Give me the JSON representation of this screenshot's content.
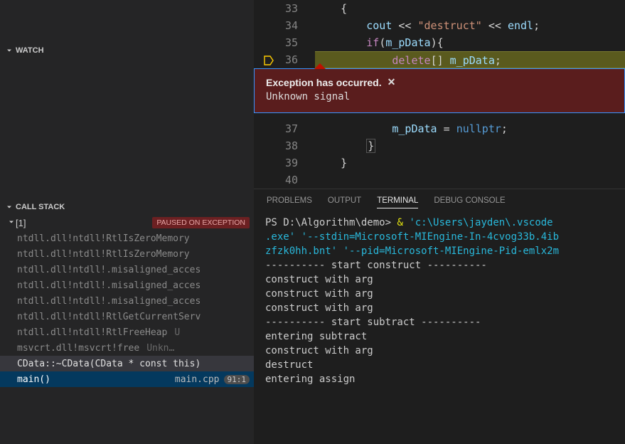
{
  "sidebar": {
    "watch": {
      "title": "WATCH"
    },
    "callstack": {
      "title": "CALL STACK",
      "thread": {
        "label": "[1]",
        "badge": "PAUSED ON EXCEPTION"
      },
      "frames": [
        {
          "label": "ntdll.dll!ntdll!RtlIsZeroMemory"
        },
        {
          "label": "ntdll.dll!ntdll!RtlIsZeroMemory"
        },
        {
          "label": "ntdll.dll!ntdll!.misaligned_acces"
        },
        {
          "label": "ntdll.dll!ntdll!.misaligned_acces"
        },
        {
          "label": "ntdll.dll!ntdll!.misaligned_acces"
        },
        {
          "label": "ntdll.dll!ntdll!RtlGetCurrentServ"
        },
        {
          "label": "ntdll.dll!ntdll!RtlFreeHeap",
          "extra": "U"
        },
        {
          "label": "msvcrt.dll!msvcrt!free",
          "extra": "Unkn…"
        }
      ],
      "active_frame": {
        "label": "CData::~CData(CData * const this)"
      },
      "selected_frame": {
        "label": "main()",
        "file": "main.cpp",
        "loc": "91:1"
      }
    }
  },
  "editor": {
    "lines": [
      {
        "num": "33"
      },
      {
        "num": "34"
      },
      {
        "num": "35"
      },
      {
        "num": "36"
      },
      {
        "num": "37"
      },
      {
        "num": "38"
      },
      {
        "num": "39"
      },
      {
        "num": "40"
      }
    ],
    "tokens": {
      "l33": "{",
      "l34_cout": "cout",
      "l34_op1": " << ",
      "l34_str": "\"destruct\"",
      "l34_op2": " << ",
      "l34_endl": "endl",
      "l34_semi": ";",
      "l35_if": "if",
      "l35_open": "(",
      "l35_var": "m_pData",
      "l35_close": "){",
      "l36_del": "delete",
      "l36_br": "[] ",
      "l36_var": "m_pData",
      "l36_semi": ";",
      "l37_var": "m_pData",
      "l37_eq": " = ",
      "l37_null": "nullptr",
      "l37_semi": ";",
      "l38": "}",
      "l39": "}"
    }
  },
  "exception": {
    "title": "Exception has occurred.",
    "message": "Unknown signal"
  },
  "panel": {
    "tabs": {
      "problems": "PROBLEMS",
      "output": "OUTPUT",
      "terminal": "TERMINAL",
      "debug": "DEBUG CONSOLE"
    }
  },
  "terminal": {
    "prompt_prefix": "PS ",
    "prompt_path": "D:\\Algorithm\\demo> ",
    "amp": "& ",
    "cmd1": "'c:\\Users\\jayden\\.vscode",
    "cmd2": ".exe' '--stdin=Microsoft-MIEngine-In-4cvog33b.4ib",
    "cmd3": "zfzk0hh.bnt' '--pid=Microsoft-MIEngine-Pid-emlx2m",
    "out": [
      "---------- start construct ----------",
      "construct with arg",
      "construct with arg",
      "construct with arg",
      "---------- start subtract ----------",
      "entering subtract",
      "construct with arg",
      "destruct",
      "entering assign"
    ]
  }
}
